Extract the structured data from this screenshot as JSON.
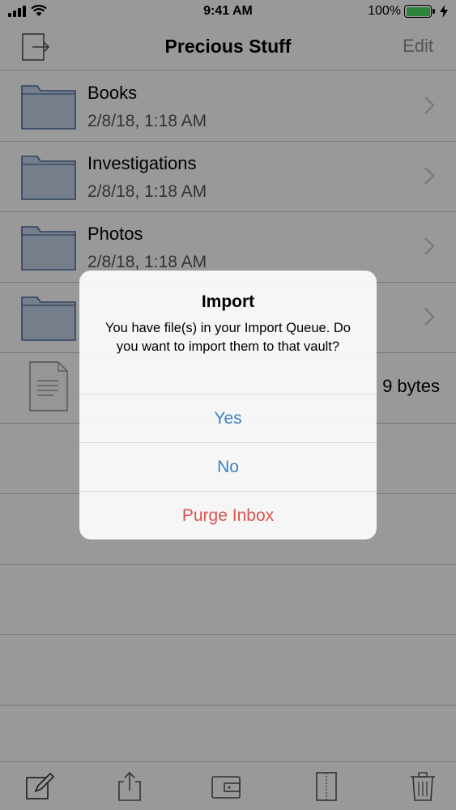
{
  "status_bar": {
    "time": "9:41 AM",
    "battery_percent": "100%",
    "battery_level": 1.0,
    "battery_color": "#4cd964"
  },
  "nav": {
    "title": "Precious Stuff",
    "edit_label": "Edit",
    "left_icon": "logout-icon"
  },
  "list": {
    "folders": [
      {
        "name": "Books",
        "date": "2/8/18, 1:18 AM"
      },
      {
        "name": "Investigations",
        "date": "2/8/18, 1:18 AM"
      },
      {
        "name": "Photos",
        "date": "2/8/18, 1:18 AM"
      },
      {
        "name": "",
        "date": ""
      }
    ],
    "file": {
      "size": "9 bytes"
    }
  },
  "toolbar": {
    "icons": [
      "compose-icon",
      "share-icon",
      "wallet-icon",
      "zip-icon",
      "trash-icon"
    ]
  },
  "alert": {
    "title": "Import",
    "message": "You have file(s) in your Import Queue. Do you want to import them to that vault?",
    "buttons": {
      "yes": "Yes",
      "no": "No",
      "purge": "Purge Inbox"
    },
    "accent_color": "#3b82c4",
    "destructive_color": "#d9544d"
  }
}
